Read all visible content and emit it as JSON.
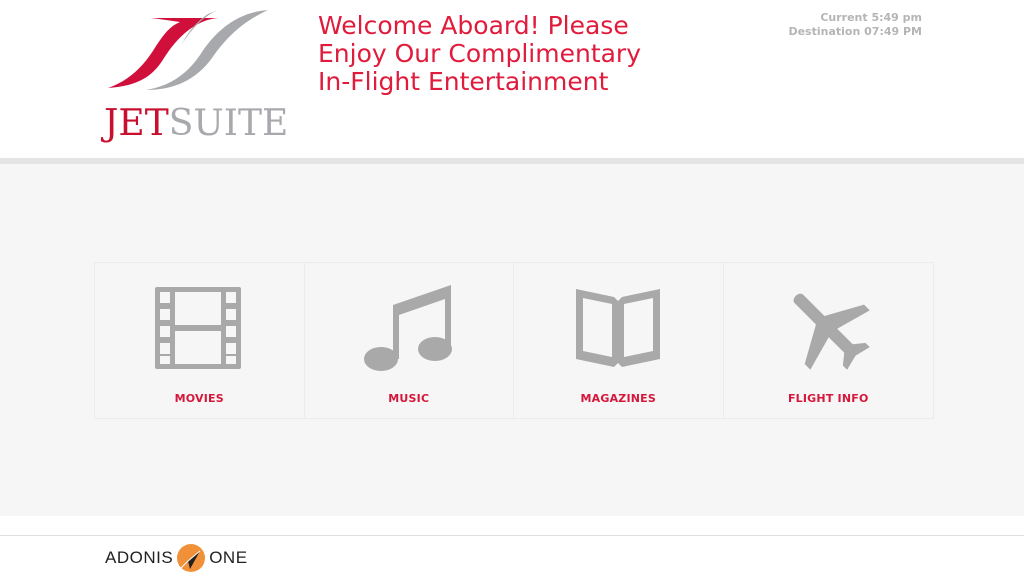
{
  "brand": {
    "logo_part1": "JET",
    "logo_part2": "SUITE",
    "logo_colors": {
      "red": "#c8102e",
      "gray": "#a7a9ac"
    }
  },
  "header": {
    "welcome_lines": [
      "Welcome Aboard! Please",
      "Enjoy Our Complimentary",
      "In-Flight Entertainment"
    ],
    "current_time": "Current 5:49 pm",
    "destination_time": "Destination 07:49 PM"
  },
  "menu": {
    "tiles": [
      {
        "label": "MOVIES",
        "icon": "film-icon"
      },
      {
        "label": "MUSIC",
        "icon": "music-note-icon"
      },
      {
        "label": "MAGAZINES",
        "icon": "open-book-icon"
      },
      {
        "label": "FLIGHT INFO",
        "icon": "airplane-icon"
      }
    ]
  },
  "footer": {
    "brand_left": "ADONIS",
    "brand_right": "ONE",
    "badge_color": "#f0913a"
  },
  "colors": {
    "accent": "#e01b3c",
    "icon_gray": "#a9a9a9",
    "panel_bg": "#f6f6f6"
  }
}
